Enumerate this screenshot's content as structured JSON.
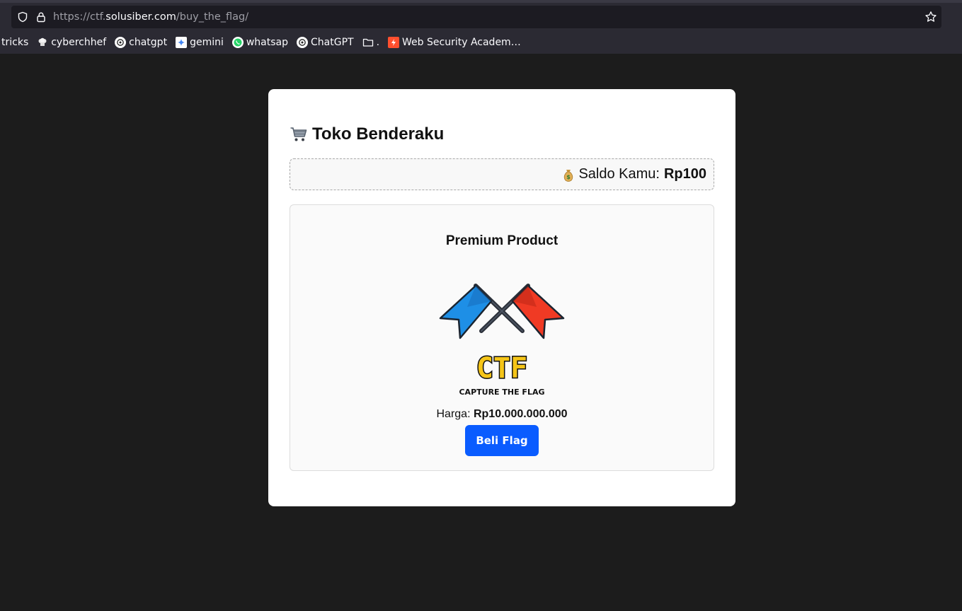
{
  "browser": {
    "url_prefix": "https://ctf.",
    "url_host": "solusiber.com",
    "url_path": "/buy_the_flag/",
    "bookmarks": [
      {
        "label": "tricks",
        "icon": "none"
      },
      {
        "label": "cyberchhef",
        "icon": "chef-hat-icon"
      },
      {
        "label": "chatgpt",
        "icon": "openai-icon"
      },
      {
        "label": "gemini",
        "icon": "gemini-icon"
      },
      {
        "label": "whatsap",
        "icon": "whatsapp-icon"
      },
      {
        "label": "ChatGPT",
        "icon": "openai-icon"
      },
      {
        "label": ".",
        "icon": "folder-icon"
      },
      {
        "label": "Web Security Academ…",
        "icon": "portswigger-icon"
      }
    ]
  },
  "page": {
    "title": "Toko Benderaku",
    "saldo_label": "Saldo Kamu:",
    "saldo_amount": "Rp100",
    "product_title": "Premium Product",
    "logo_text": "CTF",
    "logo_subtext": "CAPTURE THE FLAG",
    "price_label": "Harga:",
    "price_value": "Rp10.000.000.000",
    "buy_label": "Beli Flag"
  },
  "colors": {
    "button": "#0a5cff",
    "flag_left": "#1e8fe6",
    "flag_right": "#f03a24",
    "logo_gold": "#f5c518"
  }
}
